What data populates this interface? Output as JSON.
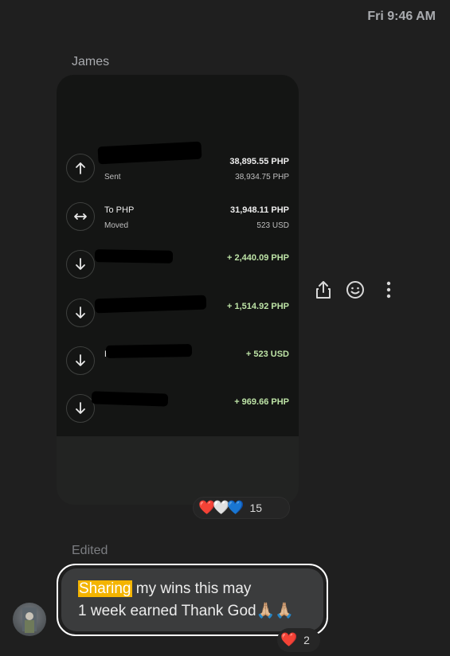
{
  "header": {
    "timestamp": "Fri 9:46 AM"
  },
  "message1": {
    "sender": "James",
    "transactions": [
      {
        "icon": "arrow-up-icon",
        "name": "",
        "sub": "Sent",
        "amount": "38,895.55 PHP",
        "sub_amount": "38,934.75 PHP",
        "green": false
      },
      {
        "icon": "exchange-icon",
        "name": "To PHP",
        "sub": "Moved",
        "amount": "31,948.11 PHP",
        "sub_amount": "523 USD",
        "green": false
      },
      {
        "icon": "arrow-down-icon",
        "name": "",
        "sub": "",
        "amount": "+ 2,440.09 PHP",
        "sub_amount": "",
        "green": true
      },
      {
        "icon": "arrow-down-icon",
        "name": "",
        "sub": "",
        "amount": "+ 1,514.92 PHP",
        "sub_amount": "",
        "green": true
      },
      {
        "icon": "arrow-down-icon",
        "name": "K",
        "sub": "",
        "amount": "+ 523 USD",
        "sub_amount": "",
        "green": true
      },
      {
        "icon": "arrow-down-icon",
        "name": "",
        "sub": "",
        "amount": "+ 969.66 PHP",
        "sub_amount": "",
        "green": true
      }
    ],
    "reactions": {
      "emojis": [
        "❤️",
        "🤍",
        "💙"
      ],
      "count": "15"
    }
  },
  "tools": {
    "share": "share-icon",
    "react": "smiley-icon",
    "more": "more-icon"
  },
  "message2": {
    "edited_label": "Edited",
    "highlight": "Sharing",
    "line1_rest": " my wins this may",
    "line2": "1 week earned Thank God🙏🏼🙏🏼",
    "reaction": {
      "emoji": "❤️",
      "count": "2"
    }
  }
}
